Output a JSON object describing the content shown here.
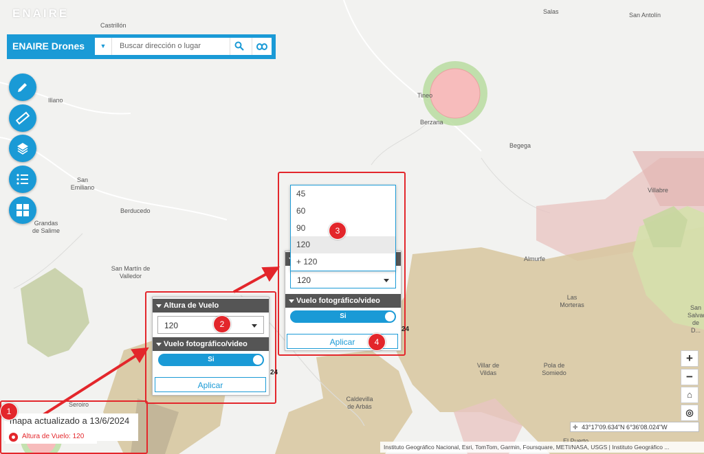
{
  "app": {
    "logo": "ENAIRE",
    "title": "ENAIRE Drones"
  },
  "search": {
    "placeholder": "Buscar dirección o lugar",
    "value": ""
  },
  "toolbar": {
    "buttons": [
      "pencil-icon",
      "ruler-icon",
      "layers-icon",
      "list-icon",
      "grid-icon"
    ]
  },
  "map": {
    "places": [
      "Castrillón",
      "Salas",
      "San Antolín",
      "Illano",
      "Tineo",
      "Berzana",
      "Begega",
      "San Emiliano",
      "Berducedo",
      "Grandas de Salime",
      "San Martín de Valledor",
      "Villabre",
      "Almurfe",
      "Las Morteras",
      "Villar de Vildas",
      "Pola de Somiedo",
      "Caldevilla de Arbás",
      "Seroiro",
      "El Puerto",
      "San Salvador de D..."
    ],
    "coordinates": "43°17'09.634\"N 6°36'08.024\"W",
    "attribution": "Instituto Geográfico Nacional, Esri, TomTom, Garmin, Foursquare, METI/NASA, USGS | Instituto Geográfico ..."
  },
  "status": {
    "updated": "mapa actualizado a  13/6/2024",
    "height_label": "Altura de Vuelo: 120"
  },
  "panel_small": {
    "height_title": "Altura de Vuelo",
    "height_value": "120",
    "video_title": "Vuelo fotográfico/video",
    "toggle_label": "Si",
    "apply": "Aplicar",
    "edge_number": "24"
  },
  "panel_large": {
    "options": [
      "45",
      "60",
      "90",
      "120",
      "+ 120"
    ],
    "selected": "120",
    "height_value": "120",
    "video_title": "Vuelo fotográfico/video",
    "toggle_label": "Si",
    "apply": "Aplicar",
    "edge_number": "24"
  },
  "annotations": [
    "1",
    "2",
    "3",
    "4"
  ],
  "colors": {
    "accent": "#1a9ad6",
    "annotation": "#e3262b"
  }
}
